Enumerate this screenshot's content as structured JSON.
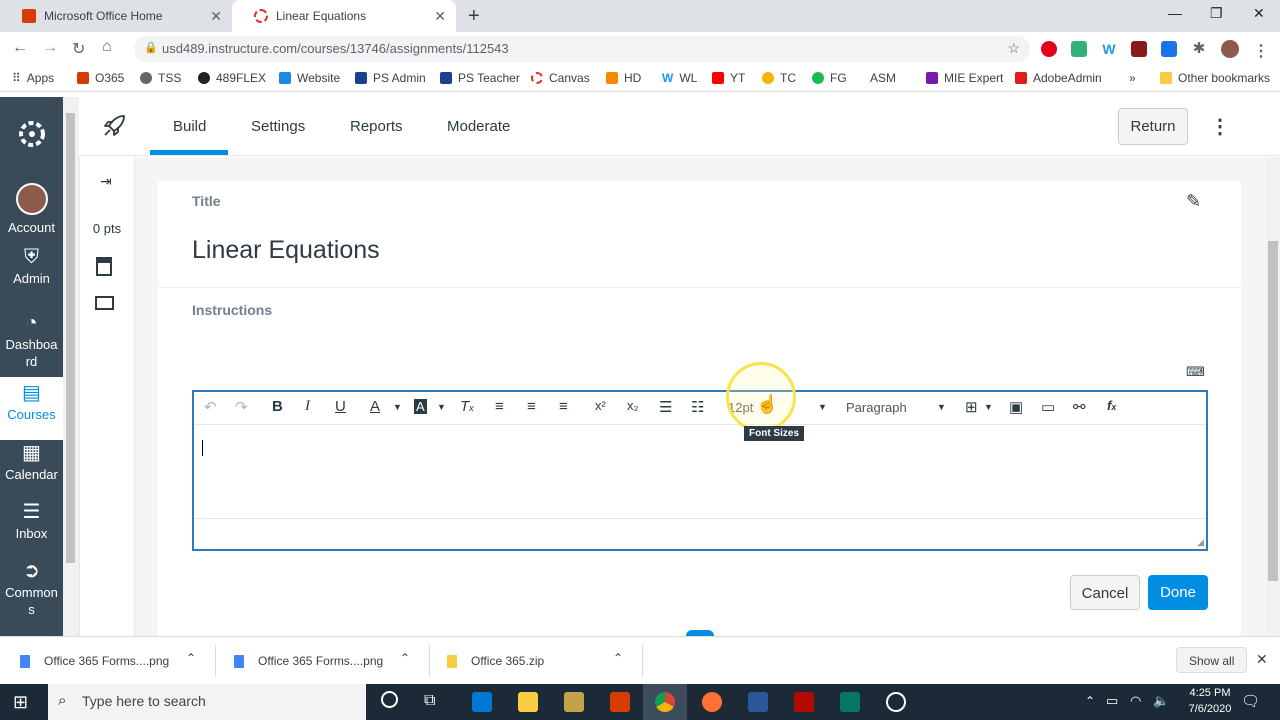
{
  "browser": {
    "tabs": [
      {
        "title": "Microsoft Office Home"
      },
      {
        "title": "Linear Equations"
      }
    ],
    "url": "usd489.instructure.com/courses/13746/assignments/112543",
    "bookmarks": [
      "Apps",
      "O365",
      "TSS",
      "489FLEX",
      "Website",
      "PS Admin",
      "PS Teacher",
      "Canvas",
      "HD",
      "WL",
      "YT",
      "TC",
      "FG",
      "ASM",
      "MIE Expert",
      "AdobeAdmin"
    ],
    "bookmarks_overflow": "»",
    "other_bookmarks": "Other bookmarks"
  },
  "global_nav": {
    "items": [
      {
        "label": "Account",
        "icon": "avatar"
      },
      {
        "label": "Admin",
        "icon": "shield-icon"
      },
      {
        "label": "Dashboard",
        "icon": "dashboard-icon"
      },
      {
        "label": "Courses",
        "icon": "courses-icon"
      },
      {
        "label": "Calendar",
        "icon": "calendar-icon"
      },
      {
        "label": "Inbox",
        "icon": "inbox-icon"
      },
      {
        "label": "Commons",
        "icon": "commons-icon"
      }
    ]
  },
  "quiz_header": {
    "tabs": [
      "Build",
      "Settings",
      "Reports",
      "Moderate"
    ],
    "active_tab": "Build",
    "return_label": "Return"
  },
  "rail": {
    "points": "0 pts"
  },
  "question": {
    "title_label": "Title",
    "title_value": "Linear Equations",
    "instructions_label": "Instructions"
  },
  "editor": {
    "font_size": "12pt",
    "block_format": "Paragraph",
    "tooltip": "Font Sizes"
  },
  "actions": {
    "cancel_label": "Cancel",
    "done_label": "Done"
  },
  "downloads": [
    {
      "name": "Office 365 Forms....png"
    },
    {
      "name": "Office 365 Forms....png"
    },
    {
      "name": "Office 365.zip"
    }
  ],
  "downloads_show_all": "Show all",
  "taskbar": {
    "search_placeholder": "Type here to search",
    "time": "4:25 PM",
    "date": "7/6/2020"
  },
  "colors": {
    "canvas_nav": "#394b58",
    "accent_blue": "#008ee2",
    "editor_border": "#2b7abc"
  }
}
